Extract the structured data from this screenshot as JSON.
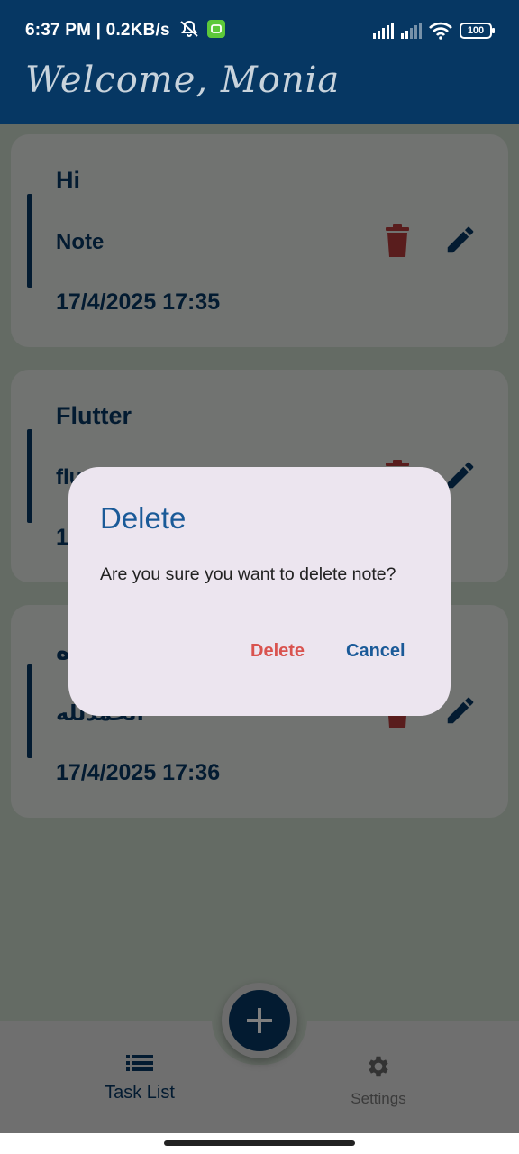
{
  "status_bar": {
    "time_text": "6:37 PM | 0.2KB/s",
    "battery": "100"
  },
  "header": {
    "title": "Welcome, Monia"
  },
  "notes": [
    {
      "title": "Hi",
      "note": "Note",
      "date": "17/4/2025 17:35"
    },
    {
      "title": "Flutter",
      "note": "flu",
      "date": "1"
    },
    {
      "title": "ه",
      "note": "الحمدلله",
      "date": "17/4/2025 17:36"
    }
  ],
  "dialog": {
    "title": "Delete",
    "message": "Are you sure you want to delete note?",
    "delete_label": "Delete",
    "cancel_label": "Cancel"
  },
  "bottom_nav": {
    "task_list_label": "Task List",
    "settings_label": "Settings"
  },
  "colors": {
    "primary": "#063763",
    "danger": "#c0392b",
    "dialog_bg": "#ece5ef"
  },
  "icons": [
    "mute-icon",
    "app-notification-icon",
    "signal-icon",
    "wifi-icon",
    "battery-icon",
    "trash-icon",
    "edit-icon",
    "plus-icon",
    "list-icon",
    "gear-icon"
  ]
}
